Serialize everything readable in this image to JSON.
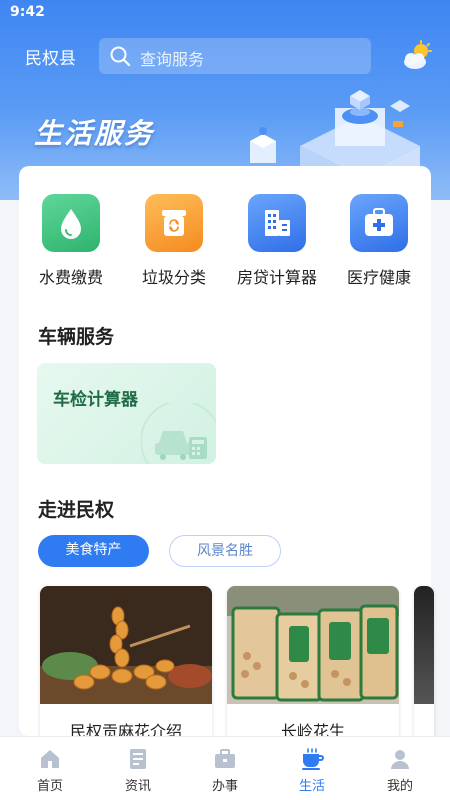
{
  "status_bar": {
    "time": "9:42"
  },
  "header": {
    "city": "民权县",
    "search_placeholder": "查询服务",
    "weather_icon": "partly-cloudy-icon"
  },
  "banner": {
    "title": "生活服务"
  },
  "services": [
    {
      "label": "水费缴费",
      "icon": "water-drop-icon",
      "color": "#3ec27f"
    },
    {
      "label": "垃圾分类",
      "icon": "trash-bin-icon",
      "color": "#f7a23b"
    },
    {
      "label": "房贷计算器",
      "icon": "building-icon",
      "color": "#3f86f2"
    },
    {
      "label": "医疗健康",
      "icon": "medical-kit-icon",
      "color": "#3f86f2"
    }
  ],
  "vehicle_section": {
    "title": "车辆服务",
    "items": [
      {
        "label": "车检计算器",
        "icon": "car-calculator-icon"
      }
    ]
  },
  "explore_section": {
    "title": "走进民权",
    "tabs": [
      {
        "label": "美食特产",
        "active": true
      },
      {
        "label": "风景名胜",
        "active": false
      }
    ],
    "cards": [
      {
        "title": "民权贡麻花介绍"
      },
      {
        "title": "长岭花生"
      }
    ]
  },
  "tab_bar": {
    "active_color": "#2f7cf2",
    "items": [
      {
        "label": "首页",
        "icon": "home-icon",
        "active": false
      },
      {
        "label": "资讯",
        "icon": "news-icon",
        "active": false
      },
      {
        "label": "办事",
        "icon": "briefcase-icon",
        "active": false
      },
      {
        "label": "生活",
        "icon": "coffee-cup-icon",
        "active": true
      },
      {
        "label": "我的",
        "icon": "user-icon",
        "active": false
      }
    ]
  }
}
